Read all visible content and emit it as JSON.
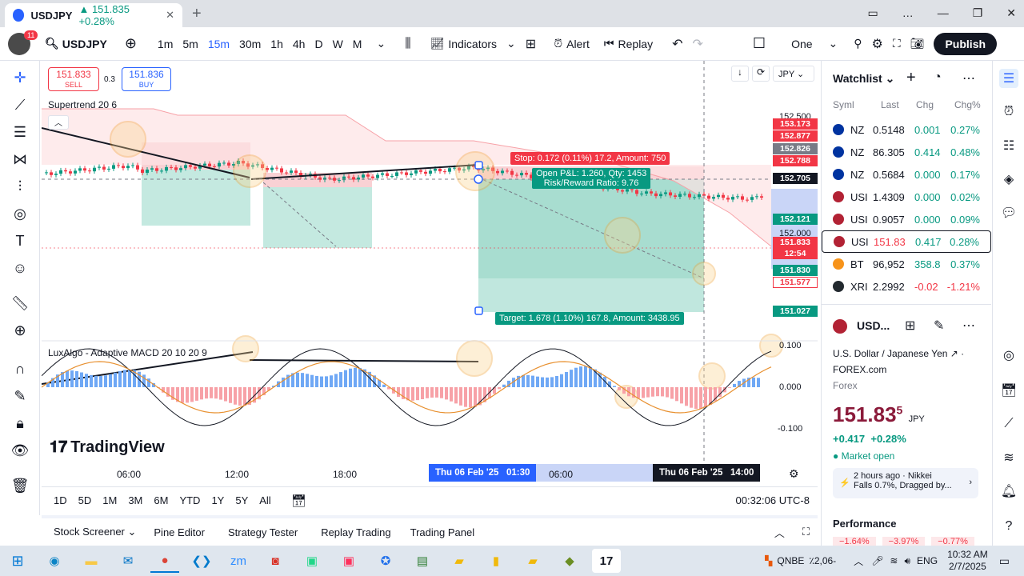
{
  "browser": {
    "tab_title": "USDJPY",
    "tab_price": "▲ 151.835 +0.28%",
    "new_tab": "+",
    "window_controls": [
      "▭",
      "…",
      "—",
      "❐",
      "✕"
    ]
  },
  "toolbar": {
    "notif_count": "11",
    "symbol": "USDJPY",
    "timeframes": [
      "1m",
      "5m",
      "15m",
      "30m",
      "1h",
      "4h",
      "D",
      "W",
      "M"
    ],
    "active_timeframe": "15m",
    "indicators": "Indicators",
    "alert": "Alert",
    "replay": "Replay",
    "layout": "One",
    "publish": "Publish"
  },
  "order": {
    "sell_price": "151.833",
    "sell_label": "SELL",
    "spread": "0.3",
    "buy_price": "151.836",
    "buy_label": "BUY"
  },
  "chart": {
    "indicator_main": "Supertrend 20 6",
    "indicator_sub": "LuxAlgo - Adaptive MACD 20 10 20 9",
    "logo": "TradingView",
    "currency": "JPY",
    "stop_label": "Stop: 0.172 (0.11%) 17.2, Amount: 750",
    "pnl_label": "Open P&L: 1.260, Qty: 1453",
    "rr_label": "Risk/Reward Ratio: 9.76",
    "target_label": "Target: 1.678 (1.10%) 167.8, Amount: 3438.95",
    "price_ticks": [
      "152.500",
      "152.000"
    ],
    "price_badges": [
      {
        "v": "153.173",
        "c": "#f23645"
      },
      {
        "v": "152.877",
        "c": "#f23645"
      },
      {
        "v": "152.826",
        "c": "#787b86"
      },
      {
        "v": "152.788",
        "c": "#f23645"
      },
      {
        "v": "152.705",
        "c": "#131722"
      },
      {
        "v": "152.121",
        "c": "#089981"
      },
      {
        "v": "151.833",
        "c": "#f23645"
      },
      {
        "v": "12:54",
        "c": "#f23645"
      },
      {
        "v": "151.830",
        "c": "#089981"
      },
      {
        "v": "151.577",
        "c": "#ffffff"
      },
      {
        "v": "151.027",
        "c": "#089981"
      }
    ],
    "macd_ticks": [
      "0.100",
      "0.000",
      "-0.100"
    ],
    "time_ticks": [
      "06:00",
      "12:00",
      "18:00",
      "06:00"
    ],
    "time_start": "Thu 06 Feb '25   01:30",
    "time_end": "Thu 06 Feb '25   14:00"
  },
  "ranges": [
    "1D",
    "5D",
    "1M",
    "3M",
    "6M",
    "YTD",
    "1Y",
    "5Y",
    "All"
  ],
  "clock": "00:32:06 UTC-8",
  "bottom_tabs": [
    "Stock Screener",
    "Pine Editor",
    "Strategy Tester",
    "Replay Trading",
    "Trading Panel"
  ],
  "watchlist": {
    "title": "Watchlist",
    "headers": [
      "Syml",
      "Last",
      "Chg",
      "Chg%"
    ],
    "rows": [
      {
        "sym": "NZ",
        "last": "0.5148",
        "chg": "0.001",
        "pct": "0.27%",
        "flag": "#0033a0"
      },
      {
        "sym": "NZ",
        "last": "86.305",
        "chg": "0.414",
        "pct": "0.48%",
        "flag": "#0033a0"
      },
      {
        "sym": "NZ",
        "last": "0.5684",
        "chg": "0.000",
        "pct": "0.17%",
        "flag": "#0033a0"
      },
      {
        "sym": "USI",
        "last": "1.4309",
        "chg": "0.000",
        "pct": "0.02%",
        "flag": "#b22234"
      },
      {
        "sym": "USI",
        "last": "0.9057",
        "chg": "0.000",
        "pct": "0.09%",
        "flag": "#b22234"
      },
      {
        "sym": "USI",
        "last": "151.83",
        "chg": "0.417",
        "pct": "0.28%",
        "flag": "#b22234"
      },
      {
        "sym": "BT",
        "last": "96,952",
        "chg": "358.8",
        "pct": "0.37%",
        "flag": "#f7931a"
      },
      {
        "sym": "XRI",
        "last": "2.2992",
        "chg": "-0.02",
        "pct": "-1.21%",
        "flag": "#23292f"
      }
    ]
  },
  "details": {
    "symbol": "USD...",
    "name": "U.S. Dollar / Japanese Yen",
    "exchange": "FOREX.com",
    "type": "Forex",
    "price_main": "151.83",
    "price_sup": "5",
    "currency": "JPY",
    "change": "+0.417",
    "change_pct": "+0.28%",
    "status": "Market open",
    "news_time": "2 hours ago · Nikkei",
    "news_text": "Falls 0.7%, Dragged by...",
    "performance": "Performance",
    "perf_values": [
      "−1.64%",
      "−3.97%",
      "−0.77%"
    ]
  },
  "taskbar": {
    "ticker": "QNBE",
    "ticker_val": "٪2,06-",
    "lang": "ENG",
    "time": "10:32 AM",
    "date": "2/7/2025"
  }
}
